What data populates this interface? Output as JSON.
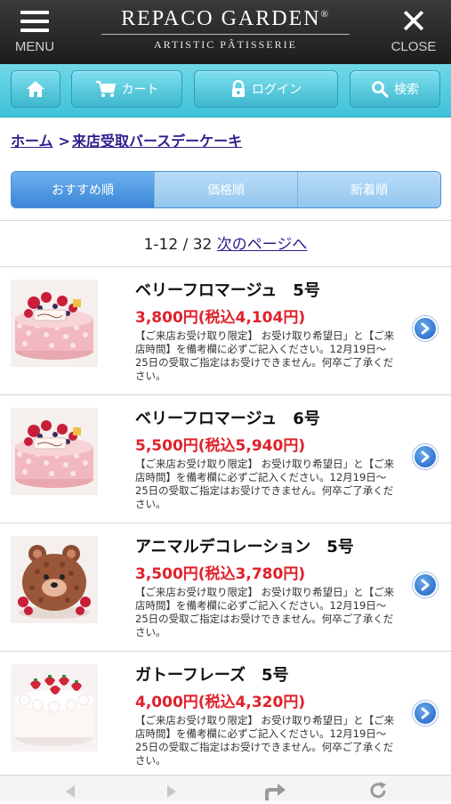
{
  "header": {
    "menu_label": "MENU",
    "close_label": "CLOSE",
    "brand_name": "REPACO GARDEN",
    "brand_mark": "®",
    "brand_subtitle": "ARTISTIC PÂTISSERIE"
  },
  "nav": {
    "home_icon": "home-icon",
    "cart_label": "カート",
    "login_label": "ログイン",
    "search_label": "検索"
  },
  "breadcrumb": {
    "home": "ホーム",
    "separator": ">",
    "current": "来店受取バースデーケーキ"
  },
  "sort_tabs": [
    "おすすめ順",
    "価格順",
    "新着順"
  ],
  "pager": {
    "range": "1-12 / 32",
    "next_label": "次のページへ"
  },
  "products": [
    {
      "name": "ベリーフロマージュ　5号",
      "price": "3,800円(税込4,104円)",
      "description": "【ご来店お受け取り限定】 お受け取り希望日」と【ご来店時間】を備考欄に必ずご記入ください。12月19日〜25日の受取ご指定はお受けできません。何卒ご了承ください。",
      "image": "berry-cake"
    },
    {
      "name": "ベリーフロマージュ　6号",
      "price": "5,500円(税込5,940円)",
      "description": "【ご来店お受け取り限定】 お受け取り希望日」と【ご来店時間】を備考欄に必ずご記入ください。12月19日〜25日の受取ご指定はお受けできません。何卒ご了承ください。",
      "image": "berry-cake"
    },
    {
      "name": "アニマルデコレーション　5号",
      "price": "3,500円(税込3,780円)",
      "description": "【ご来店お受け取り限定】 お受け取り希望日」と【ご来店時間】を備考欄に必ずご記入ください。12月19日〜25日の受取ご指定はお受けできません。何卒ご了承ください。",
      "image": "bear-cake"
    },
    {
      "name": "ガトーフレーズ　5号",
      "price": "4,000円(税込4,320円)",
      "description": "【ご来店お受け取り限定】 お受け取り希望日」と【ご来店時間】を備考欄に必ずご記入ください。12月19日〜25日の受取ご指定はお受けできません。何卒ご了承ください。",
      "image": "strawberry-shortcake"
    }
  ],
  "colors": {
    "header_bg": "#1c1c1c",
    "nav_bg": "#3fc2d8",
    "price": "#e0212b",
    "link": "#2c1f8c",
    "sort_active": "#3b86d6",
    "sort_inactive": "#93c6ee"
  }
}
